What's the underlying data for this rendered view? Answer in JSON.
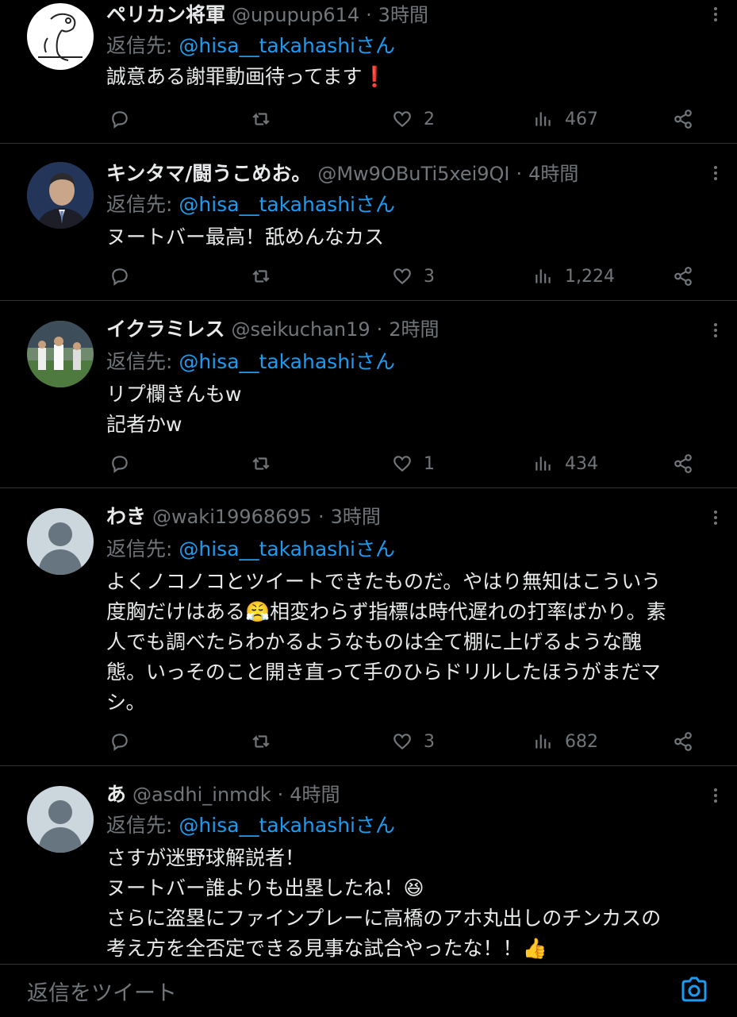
{
  "tweets": [
    {
      "name": "ペリカン将軍",
      "handle": "@upupup614",
      "sep": "·",
      "time": "3時間",
      "reply_label": "返信先:",
      "reply_to": "@hisa__takahashiさん",
      "text": "誠意ある謝罪動画待ってます❗",
      "likes": "2",
      "views": "467"
    },
    {
      "name": "キンタマ/闘うこめお。",
      "handle": "@Mw9OBuTi5xei9QI",
      "sep": "·",
      "time": "4時間",
      "reply_label": "返信先:",
      "reply_to": "@hisa__takahashiさん",
      "text": "ヌートバー最高！舐めんなカス",
      "likes": "3",
      "views": "1,224"
    },
    {
      "name": "イクラミレス",
      "handle": "@seikuchan19",
      "sep": "·",
      "time": "2時間",
      "reply_label": "返信先:",
      "reply_to": "@hisa__takahashiさん",
      "text": "リプ欄きんもw\n記者かw",
      "likes": "1",
      "views": "434"
    },
    {
      "name": "わき",
      "handle": "@waki19968695",
      "sep": "·",
      "time": "3時間",
      "reply_label": "返信先:",
      "reply_to": "@hisa__takahashiさん",
      "text": "よくノコノコとツイートできたものだ。やはり無知はこういう\n度胸だけはある😤相変わらず指標は時代遅れの打率ばかり。素\n人でも調べたらわかるようなものは全て棚に上げるような醜\n態。いっそのこと開き直って手のひらドリルしたほうがまだマ\nシ。",
      "likes": "3",
      "views": "682"
    },
    {
      "name": "あ",
      "handle": "@asdhi_inmdk",
      "sep": "·",
      "time": "4時間",
      "reply_label": "返信先:",
      "reply_to": "@hisa__takahashiさん",
      "text": "さすが迷野球解説者！\nヌートバー誰よりも出塁したね！😆\nさらに盗塁にファインプレーに高橋のアホ丸出しのチンカスの\n考え方を全否定できる見事な試合やったな！！👍"
    }
  ],
  "composer": {
    "placeholder": "返信をツイート"
  },
  "icons": [
    "reply-icon",
    "retweet-icon",
    "like-icon",
    "views-icon",
    "share-icon",
    "more-icon",
    "camera-icon"
  ],
  "colors": {
    "background": "#000000",
    "link": "#1d9bf0",
    "muted": "#71767b",
    "text": "#e7e9ea"
  }
}
